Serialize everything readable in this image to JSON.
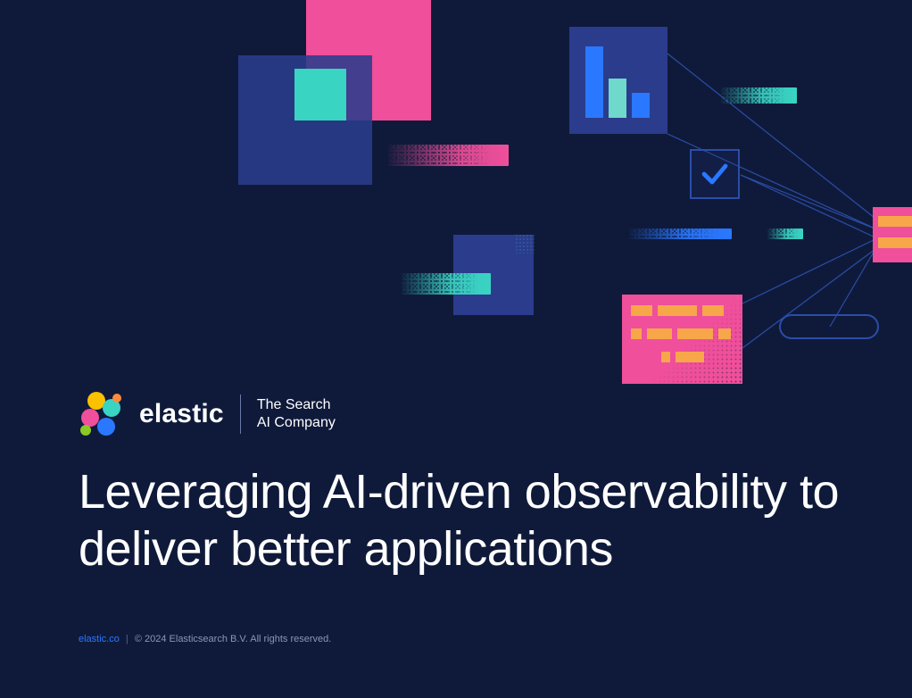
{
  "brand": {
    "wordmark": "elastic",
    "tagline_line1": "The Search",
    "tagline_line2": "AI Company"
  },
  "headline": "Leveraging AI-driven observability to deliver better applications",
  "footer": {
    "link_text": "elastic.co",
    "separator": "|",
    "copyright": "© 2024 Elasticsearch B.V. All rights reserved."
  },
  "icons": {
    "check": "checkmark-icon",
    "bar_chart": "bar-chart-icon",
    "card": "data-card-icon",
    "pill": "pill-outline-icon",
    "logo": "elastic-logo-icon"
  }
}
